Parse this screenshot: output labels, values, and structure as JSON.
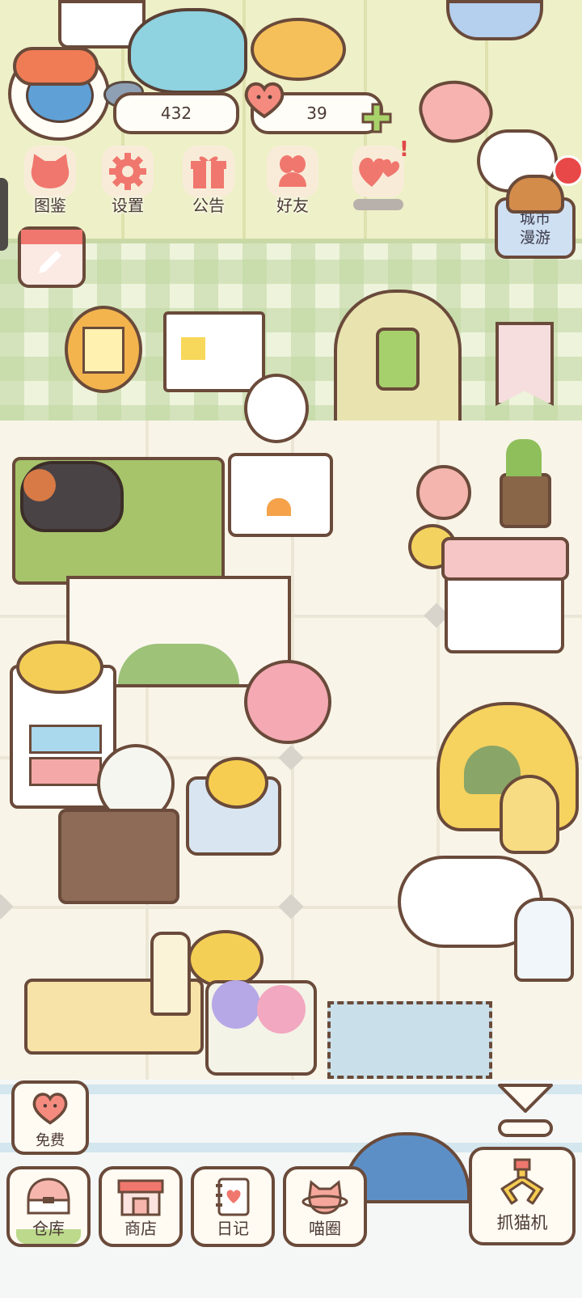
{
  "hud": {
    "fish_count": "432",
    "heart_count": "39"
  },
  "menu": [
    {
      "label": "图鉴",
      "icon": "cat-head-icon"
    },
    {
      "label": "设置",
      "icon": "gear-icon"
    },
    {
      "label": "公告",
      "icon": "gift-icon"
    },
    {
      "label": "好友",
      "icon": "friends-icon"
    },
    {
      "label": "",
      "icon": "hearts-icon"
    }
  ],
  "city_roam": {
    "label": "城市\n漫游",
    "line1": "城市",
    "line2": "漫游"
  },
  "bottom": {
    "free_label": "免费",
    "nav": [
      {
        "label": "仓库",
        "icon": "storage-icon"
      },
      {
        "label": "商店",
        "icon": "shop-icon"
      },
      {
        "label": "日记",
        "icon": "diary-icon"
      },
      {
        "label": "喵圈",
        "icon": "cat-planet-icon"
      }
    ],
    "claw_label": "抓猫机"
  },
  "colors": {
    "outline": "#6a4a3a",
    "accent_pink": "#f0776e",
    "accent_green": "#a8d26a",
    "notice_red": "#e94848"
  }
}
